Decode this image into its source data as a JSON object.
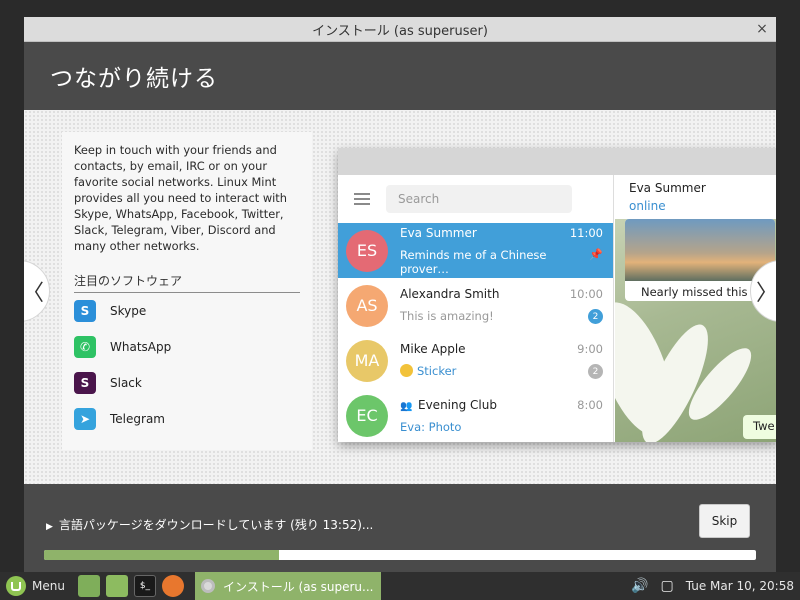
{
  "window": {
    "title": "インストール (as superuser)",
    "close_icon": "×"
  },
  "slide": {
    "title": "つながり続ける",
    "description": "Keep in touch with your friends and contacts, by email, IRC or on your favorite social networks. Linux Mint provides all you need to interact with Skype, WhatsApp, Facebook, Twitter, Slack, Telegram, Viber, Discord and many other networks.",
    "featured_title": "注目のソフトウェア",
    "software": [
      {
        "name": "Skype",
        "icon": "skype-icon",
        "color": "#2b8fd9",
        "glyph": "S"
      },
      {
        "name": "WhatsApp",
        "icon": "whatsapp-icon",
        "color": "#2ec264",
        "glyph": "✆"
      },
      {
        "name": "Slack",
        "icon": "slack-icon",
        "color": "#4a154b",
        "glyph": "S"
      },
      {
        "name": "Telegram",
        "icon": "telegram-icon",
        "color": "#35a3dd",
        "glyph": "➤"
      }
    ],
    "prev_arrow": "〈",
    "next_arrow": "〉"
  },
  "telegram": {
    "search_placeholder": "Search",
    "chats": [
      {
        "initials": "ES",
        "name": "Eva Summer",
        "time": "11:00",
        "preview": "Reminds me of a Chinese prover…",
        "avatar_color": "#e46a74"
      },
      {
        "initials": "AS",
        "name": "Alexandra Smith",
        "time": "10:00",
        "preview": "This is amazing!",
        "badge": "2",
        "avatar_color": "#f5a872"
      },
      {
        "initials": "MA",
        "name": "Mike Apple",
        "time": "9:00",
        "preview": "Sticker",
        "badge": "2",
        "avatar_color": "#e8c868"
      },
      {
        "initials": "EC",
        "name": "Evening Club",
        "time": "8:00",
        "preview": "Eva: Photo",
        "avatar_color": "#6cc66a"
      }
    ],
    "open_chat": {
      "name": "Eva Summer",
      "status": "online",
      "photo_caption": "Nearly missed this s",
      "bubble": "Twe"
    }
  },
  "progress": {
    "status": "言語パッケージをダウンロードしています (残り 13:52)...",
    "skip_label": "Skip",
    "fraction": 0.33
  },
  "taskbar": {
    "menu_label": "Menu",
    "task_label": "インストール (as superu...",
    "clock": "Tue Mar 10, 20:58",
    "terminal_glyph": "$_"
  }
}
